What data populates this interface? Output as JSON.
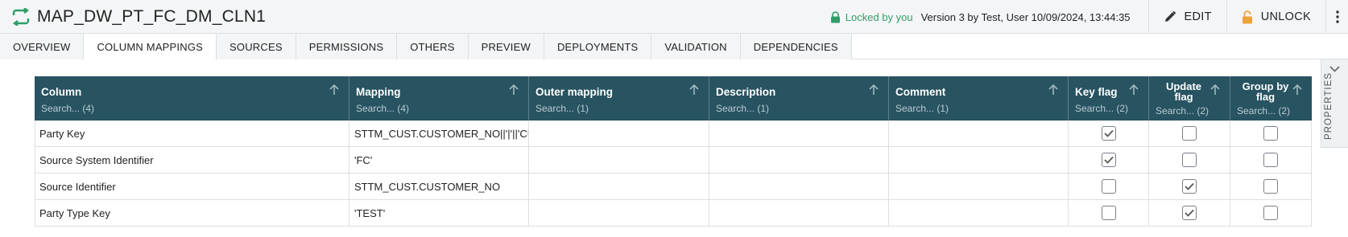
{
  "header": {
    "title": "MAP_DW_PT_FC_DM_CLN1",
    "lock_status": "Locked by you",
    "version_info": "Version 3 by Test, User 10/09/2024, 13:44:35",
    "edit_label": "EDIT",
    "unlock_label": "UNLOCK",
    "accent_color": "#2f9e6a",
    "lock_icon_color": "#f0a23a"
  },
  "tabs": [
    {
      "label": "OVERVIEW",
      "active": false
    },
    {
      "label": "COLUMN MAPPINGS",
      "active": true
    },
    {
      "label": "SOURCES",
      "active": false
    },
    {
      "label": "PERMISSIONS",
      "active": false
    },
    {
      "label": "OTHERS",
      "active": false
    },
    {
      "label": "PREVIEW",
      "active": false
    },
    {
      "label": "DEPLOYMENTS",
      "active": false
    },
    {
      "label": "VALIDATION",
      "active": false
    },
    {
      "label": "DEPENDENCIES",
      "active": false
    }
  ],
  "properties_label": "PROPERTIES",
  "table": {
    "header_color": "#285361",
    "columns": [
      {
        "name": "Column",
        "search": "Search... (4)"
      },
      {
        "name": "Mapping",
        "search": "Search... (4)"
      },
      {
        "name": "Outer mapping",
        "search": "Search... (1)"
      },
      {
        "name": "Description",
        "search": "Search... (1)"
      },
      {
        "name": "Comment",
        "search": "Search... (1)"
      },
      {
        "name": "Key flag",
        "search": "Search... (2)"
      },
      {
        "name": "Update flag",
        "name_line1": "Update",
        "name_line2": "flag",
        "search": "Search... (2)"
      },
      {
        "name": "Group by flag",
        "name_line1": "Group by",
        "name_line2": "flag",
        "search": "Search... (2)"
      }
    ],
    "rows": [
      {
        "column": "Party Key",
        "mapping": "STTM_CUST.CUSTOMER_NO||'|'||'CUST",
        "outer_mapping": "",
        "description": "",
        "comment": "",
        "key_flag": true,
        "update_flag": false,
        "group_by_flag": false
      },
      {
        "column": "Source System Identifier",
        "mapping": "'FC'",
        "outer_mapping": "",
        "description": "",
        "comment": "",
        "key_flag": true,
        "update_flag": false,
        "group_by_flag": false
      },
      {
        "column": "Source Identifier",
        "mapping": "STTM_CUST.CUSTOMER_NO",
        "outer_mapping": "",
        "description": "",
        "comment": "",
        "key_flag": false,
        "update_flag": true,
        "group_by_flag": false
      },
      {
        "column": "Party Type Key",
        "mapping": "'TEST'",
        "outer_mapping": "",
        "description": "",
        "comment": "",
        "key_flag": false,
        "update_flag": true,
        "group_by_flag": false
      }
    ]
  }
}
